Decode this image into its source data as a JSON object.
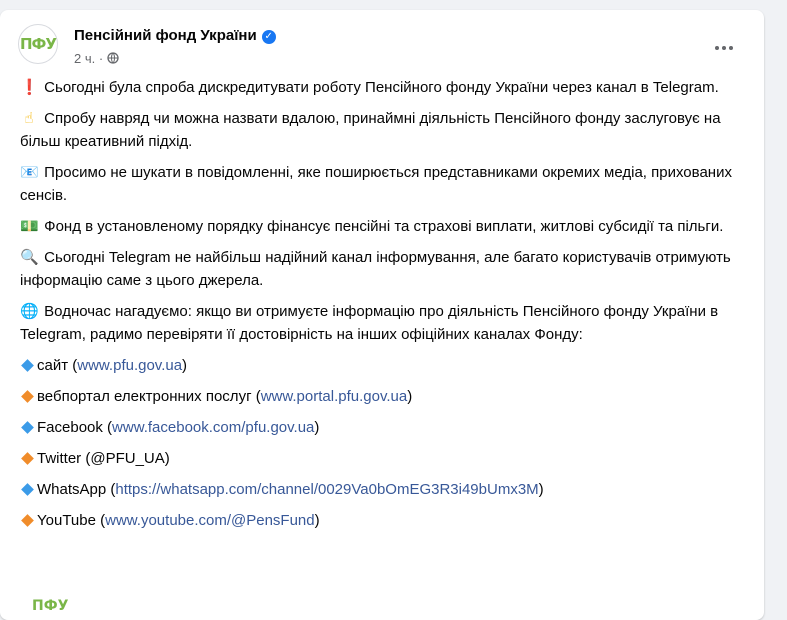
{
  "post": {
    "avatar_text": "ПФУ",
    "page_name": "Пенсійний фонд України",
    "time": "2 ч.",
    "paragraphs": [
      {
        "emoji": "❗",
        "text": "Сьогодні була спроба дискредитувати роботу Пенсійного фонду України через канал в Telegram."
      },
      {
        "emoji": "☝",
        "text": "Спробу навряд чи можна назвати вдалою, принаймні діяльність Пенсійного фонду заслуговує на більш креативний підхід."
      },
      {
        "emoji": "📧",
        "text": "Просимо не шукати в повідомленні, яке поширюється представниками окремих медіа, прихованих сенсів."
      },
      {
        "emoji": "💵",
        "text": "Фонд в установленому порядку фінансує пенсійні та страхові виплати, житлові субсидії та пільги."
      },
      {
        "emoji": "🔍",
        "text": "Сьогодні Telegram не найбільш надійний канал інформування, але багато користувачів отримують інформацію саме з цього джерела."
      },
      {
        "emoji": "🌐",
        "text": "Водночас нагадуємо: якщо ви отримуєте інформацію про діяльність Пенсійного фонду України в Telegram, радимо перевіряти її достовірність на інших офіційних каналах Фонду:"
      }
    ],
    "links": [
      {
        "label": "сайт",
        "open": " (",
        "url": "www.pfu.gov.ua",
        "close": ")"
      },
      {
        "label": "вебпортал електронних послуг",
        "open": " (",
        "url": "www.portal.pfu.gov.ua",
        "close": ")"
      },
      {
        "label": "Facebook",
        "open": " (",
        "url": "www.facebook.com/pfu.gov.ua",
        "close": ")"
      },
      {
        "label": "Twitter",
        "open": " (@PFU_UA)",
        "url": "",
        "close": ""
      },
      {
        "label": "WhatsApp",
        "open": " (",
        "url": "https://whatsapp.com/channel/0029Va0bOmEG3R3i49bUmx3M",
        "close": ")"
      },
      {
        "label": "YouTube",
        "open": " (",
        "url": "www.youtube.com/@PensFund",
        "close": ")"
      }
    ],
    "footer_logo": "ПФУ"
  },
  "colors": {
    "blue_diamond": "#3b9be8",
    "orange_diamond": "#f08c2a",
    "link": "#385898",
    "verified": "#1877f2"
  },
  "icons": {
    "verified": "verified-check-icon",
    "audience": "globe-icon",
    "more": "more-options-icon",
    "bullet_blue": "blue-diamond-icon",
    "bullet_orange": "orange-diamond-icon"
  }
}
